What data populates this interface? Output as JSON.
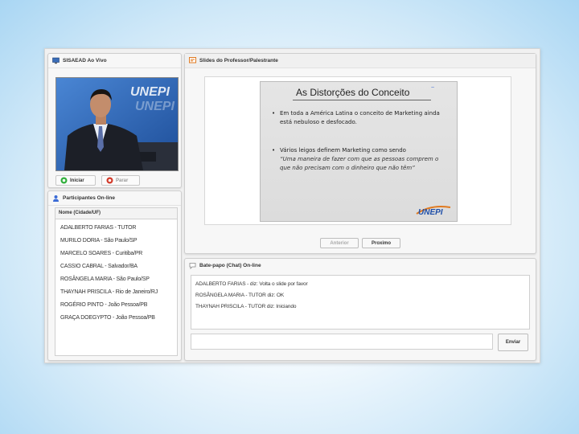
{
  "video_panel": {
    "title": "SISAEAD Ao Vivo",
    "start_label": "Iniciar",
    "stop_label": "Parar"
  },
  "participants_panel": {
    "title": "Participantes On-line",
    "column_header": "Nome (Cidade/UF)",
    "items": [
      "ADALBERTO FARIAS - TUTOR",
      "MURILO DORIA - São Paulo/SP",
      "MARCELO SOARES - Curitiba/PR",
      "CASSIO CABRAL - Salvador/BA",
      "ROSÂNGELA MARIA - São Paulo/SP",
      "THAYNAH PRISCILA - Rio de Janeiro/RJ",
      "ROGÉRIO PINTO - João Pessoa/PB",
      "GRAÇA DOEGYPTO - João Pessoa/PB"
    ]
  },
  "slides_panel": {
    "title": "Slides do Professor/Palestrante",
    "slide": {
      "title": "As Distorções do Conceito",
      "bullets": [
        "Em toda a América Latina o conceito de Marketing ainda está nebuloso e desfocado.",
        "Vários leigos definem Marketing como sendo"
      ],
      "quote": "“Uma maneira de fazer com que as pessoas comprem o que não precisam com o dinheiro que não têm”",
      "logo": "UNEPI",
      "watermark": "UNEPI"
    },
    "prev_label": "Anterior",
    "next_label": "Proximo"
  },
  "chat_panel": {
    "title": "Bate-papo (Chat) On-line",
    "messages": [
      "ADALBERTO FARIAS - diz: Volta o slide por favor",
      "ROSÂNGELA MARIA - TUTOR diz: OK",
      "THAYNAH PRISCILA - TUTOR diz: Iniciando"
    ],
    "input_value": "",
    "send_label": "Enviar"
  },
  "colors": {
    "accent_green": "#2fae3a",
    "accent_red": "#d23a2a",
    "slide_blue": "#1f4fa8",
    "tick_blue": "#3b6bd6",
    "header_icon_orange": "#e07a20"
  },
  "icons": {
    "video_panel": "monitor-icon",
    "participants_panel": "user-icon",
    "slides_panel": "presentation-icon",
    "chat_panel": "chat-bubble-icon",
    "start": "play-icon",
    "stop": "stop-icon"
  }
}
